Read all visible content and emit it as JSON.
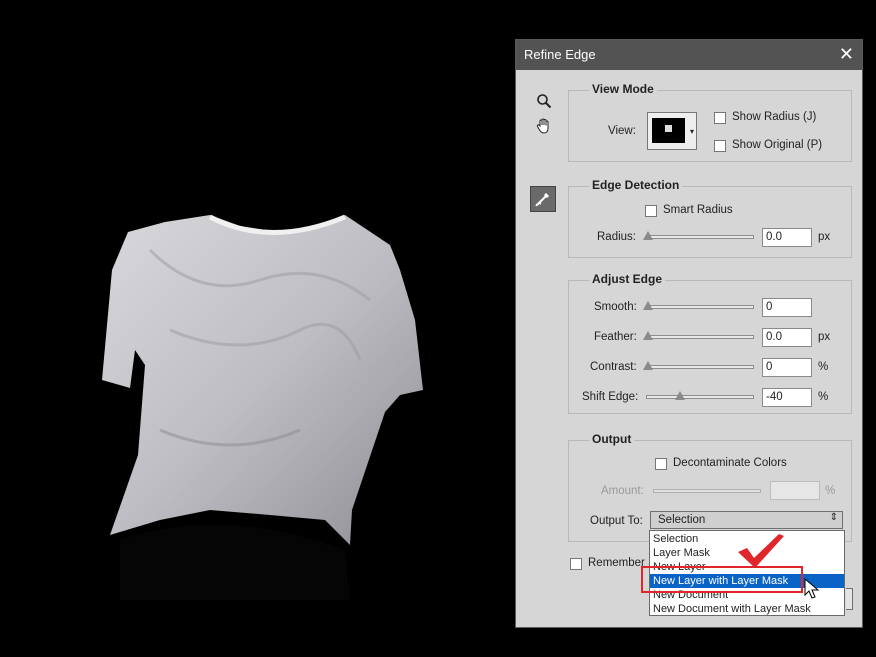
{
  "dialog": {
    "title": "Refine Edge",
    "view_mode": {
      "title": "View Mode",
      "view_label": "View:",
      "show_radius": "Show Radius (J)",
      "show_original": "Show Original (P)"
    },
    "edge_detection": {
      "title": "Edge Detection",
      "smart_radius": "Smart Radius",
      "radius_label": "Radius:",
      "radius_value": "0.0",
      "radius_unit": "px"
    },
    "adjust_edge": {
      "title": "Adjust Edge",
      "smooth_label": "Smooth:",
      "smooth_value": "0",
      "feather_label": "Feather:",
      "feather_value": "0.0",
      "feather_unit": "px",
      "contrast_label": "Contrast:",
      "contrast_value": "0",
      "contrast_unit": "%",
      "shift_label": "Shift Edge:",
      "shift_value": "-40",
      "shift_unit": "%"
    },
    "output": {
      "title": "Output",
      "decontaminate": "Decontaminate Colors",
      "amount_label": "Amount:",
      "amount_unit": "%",
      "output_to_label": "Output To:",
      "output_to_value": "Selection",
      "options": [
        "Selection",
        "Layer Mask",
        "New Layer",
        "New Layer with Layer Mask",
        "New Document",
        "New Document with Layer Mask"
      ],
      "highlighted_option": "New Layer with Layer Mask"
    },
    "remember_label": "Remember S"
  },
  "colors": {
    "highlight": "#0a64c8",
    "annotation": "#e0262b"
  }
}
